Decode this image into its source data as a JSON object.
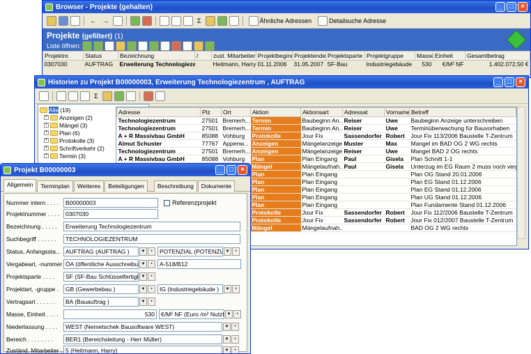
{
  "browser": {
    "title": "Browser - Projekte (gehalten)",
    "toolbar": {
      "similar_label": "Ähnliche Adressen",
      "detail_label": "Detailsuche Adresse"
    },
    "header": {
      "title": "Projekte",
      "subtitle": "(gefiltert)",
      "count": "(1)",
      "open_label": "Liste öffnen:"
    },
    "columns": [
      "Projektnr.",
      "Status",
      "Bezeichnung",
      "/",
      "zust. Mitarbeiter",
      "Projektbeginn",
      "Projektende",
      "Projektsparte",
      "Projektgruppe",
      "Masse",
      "Einheit",
      "Gesamtbetrag"
    ],
    "row": [
      "0307030",
      "AUFTRAG",
      "Erweiterung Technologiezentrum",
      "",
      "Heitmann, Harry",
      "01.11.2006",
      "31.05.2007",
      "SF-Bau",
      "Industriegebäude",
      "530",
      "€/M² NF",
      "1.402.072,50 €"
    ]
  },
  "histories": {
    "title": "Historien zu Projekt B00000003, Erweiterung Technologiezentrum , AUFTRAG",
    "tree": [
      {
        "label": "Alle",
        "count": "(19)"
      },
      {
        "label": "Anzeigen",
        "count": "(2)"
      },
      {
        "label": "Mängel",
        "count": "(3)"
      },
      {
        "label": "Plan",
        "count": "(6)"
      },
      {
        "label": "Protokolle",
        "count": "(3)"
      },
      {
        "label": "Schriftverkehr",
        "count": "(2)"
      },
      {
        "label": "Termin",
        "count": "(3)"
      }
    ],
    "columns": [
      "Adresse",
      "Plz",
      "Ort",
      "Aktion",
      "Aktionsart",
      "Adressat",
      "Vorname",
      "Betreff"
    ],
    "rows": [
      [
        "Technologiezentrum",
        "27501",
        "Bremerh...",
        "Termin",
        "Baubeginn An...",
        "Reiser",
        "Uwe",
        "Baubeginn Anzeige unterschreiben"
      ],
      [
        "Technologiezentrum",
        "27501",
        "Bremerh...",
        "Termin",
        "Baubeginn An...",
        "Reiser",
        "Uwe",
        "Terminüberwachung für Bauvorhaben"
      ],
      [
        "A + R Massivbau GmbH",
        "85088",
        "Vohburg",
        "Protokolle",
        "Jour Fix",
        "Sassendorfer",
        "Robert",
        "Jour Fix 113/2006 Baustelle T-Zentrum"
      ],
      [
        "Almut Schuster",
        "77767",
        "Appenw...",
        "Anzeigen",
        "Mängelanzeige",
        "Muster",
        "Max",
        "Mangel im BAD OG 2 WG rechts"
      ],
      [
        "Technologiezentrum",
        "27501",
        "Bremerh...",
        "Anzeigen",
        "Mängelanzeige",
        "Reiser",
        "Uwe",
        "Mangel BAD 2 OG rechts"
      ],
      [
        "A + R Massivbau GmbH",
        "85088",
        "Vohburg",
        "Plan",
        "Plan Eingang",
        "Paul",
        "Gisela",
        "Plan Schnitt 1-1"
      ],
      [
        "",
        "",
        "",
        "Mängel",
        "Mängelaufnah...",
        "Paul",
        "Gisela",
        "Unterzug im EG Raum 2 muss noch verp..."
      ],
      [
        "",
        "",
        "",
        "Plan",
        "Plan Eingang",
        "",
        "",
        "Plan OG Stand 20.01.2006"
      ],
      [
        "",
        "",
        "",
        "Plan",
        "Plan Eingang",
        "",
        "",
        "Plan EG Stand 01.12.2006"
      ],
      [
        "",
        "",
        "",
        "Plan",
        "Plan Eingang",
        "",
        "",
        "Plan EG Stand 01.12.2006"
      ],
      [
        "",
        "",
        "",
        "Plan",
        "Plan Eingang",
        "",
        "",
        "Plan UG Stand 01.12.2006"
      ],
      [
        "",
        "",
        "",
        "Plan",
        "Plan Eingang",
        "",
        "",
        "Plan Fundamente Stand 01.12.2006"
      ],
      [
        "",
        "",
        "",
        "Protokolle",
        "Jour Fix",
        "Sassendorfer",
        "Robert",
        "Jour Fix 112/2006 Baustelle T-Zentrum"
      ],
      [
        "",
        "",
        "",
        "Protokolle",
        "Jour Fix",
        "Sassendorfer",
        "Robert",
        "Jour Fix 012/2007 Baustelle T-Zentrum"
      ],
      [
        "",
        "",
        "",
        "Mängel",
        "Mängelaufnah...",
        "",
        "",
        "BAD OG 2 WG rechts"
      ]
    ]
  },
  "project": {
    "title": "Projekt B00000003",
    "tabs": [
      "Allgemein",
      "Terminplan",
      "Weiteres",
      "Beteiligungen",
      "Beschreibung",
      "Dokumente"
    ],
    "fields": {
      "nummer_intern": {
        "label": "Nummer intern . . . .",
        "value": "B00000003"
      },
      "referenz": {
        "label": "Referenzprojekt"
      },
      "projektnummer": {
        "label": "Projektnummer . . . .",
        "value": "0307030"
      },
      "bezeichnung": {
        "label": "Bezeichnung . . . . .",
        "value": "Erweiterung Technologiezentrum"
      },
      "suchbegriff": {
        "label": "Suchbegriff . . . . . .",
        "value": "TECHNOLOGIEZENTRUM"
      },
      "status": {
        "label": "Status, Anfangssta...",
        "value": "AUFTRAG (AUFTRAG )",
        "value2": "POTENZIAL (POTENZIAL )"
      },
      "vergabeart": {
        "label": "Vergabeart, -nummer",
        "value": "ÖA (öffentliche Ausschreibung )",
        "value2": "A-518/B12"
      },
      "sparte": {
        "label": "Projektsparte . . . .",
        "value": "SF (SF-Bau Schlüsselfertigbau)"
      },
      "art": {
        "label": "Projektart, -gruppe .",
        "value": "GB (Gewerbebau )",
        "value2": "IG (Industriegebäude )"
      },
      "vertragsart": {
        "label": "Vertragsart . . . . . .",
        "value": "BA (Bauauftrag )"
      },
      "masse": {
        "label": "Masse, Einheit . . . .",
        "value": "530",
        "value2": "€/M² NF (Euro /m² Nutzfl.)"
      },
      "niederlassung": {
        "label": "Niederlassung . . . .",
        "value": "WEST (Nemetschek Bausoftware WEST)"
      },
      "bereich": {
        "label": "Bereich . . . . . . . .",
        "value": "BER1 (Bereichsleitung - Herr Müller)"
      },
      "mitarbeiter": {
        "label": "Zuständ. Mitarbeiter .",
        "value": "5 (Heitmann, Harry)"
      }
    }
  }
}
